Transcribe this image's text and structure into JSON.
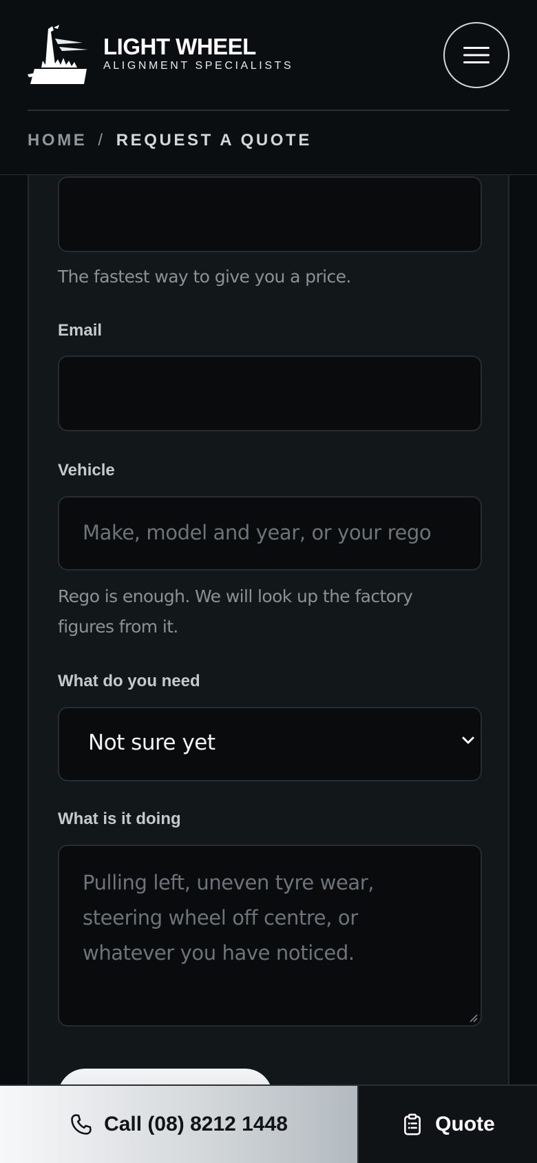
{
  "header": {
    "brand_name": "LIGHT WHEEL",
    "brand_tagline": "ALIGNMENT SPECIALISTS",
    "menu_icon": "hamburger-icon",
    "logo_icon": "lighthouse-logo-icon"
  },
  "breadcrumb": {
    "home": "HOME",
    "separator": "/",
    "current": "REQUEST A QUOTE"
  },
  "form": {
    "phone_help": "The fastest way to give you a price.",
    "email_label": "Email",
    "vehicle_label": "Vehicle",
    "vehicle_placeholder": "Make, model and year, or your rego",
    "vehicle_help": "Rego is enough. We will look up the factory figures from it.",
    "need_label": "What do you need",
    "need_selected": "Not sure yet",
    "doing_label": "What is it doing",
    "doing_placeholder": "Pulling left, uneven tyre wear, steering wheel off centre, or whatever you have noticed."
  },
  "bottom_bar": {
    "call_label": "Call (08) 8212 1448",
    "call_icon": "phone-icon",
    "quote_label": "Quote",
    "quote_icon": "clipboard-icon"
  },
  "colors": {
    "background": "#0a0d0f",
    "card": "#121719",
    "field": "#090b0d",
    "accent_light": "#f4f5f6"
  }
}
